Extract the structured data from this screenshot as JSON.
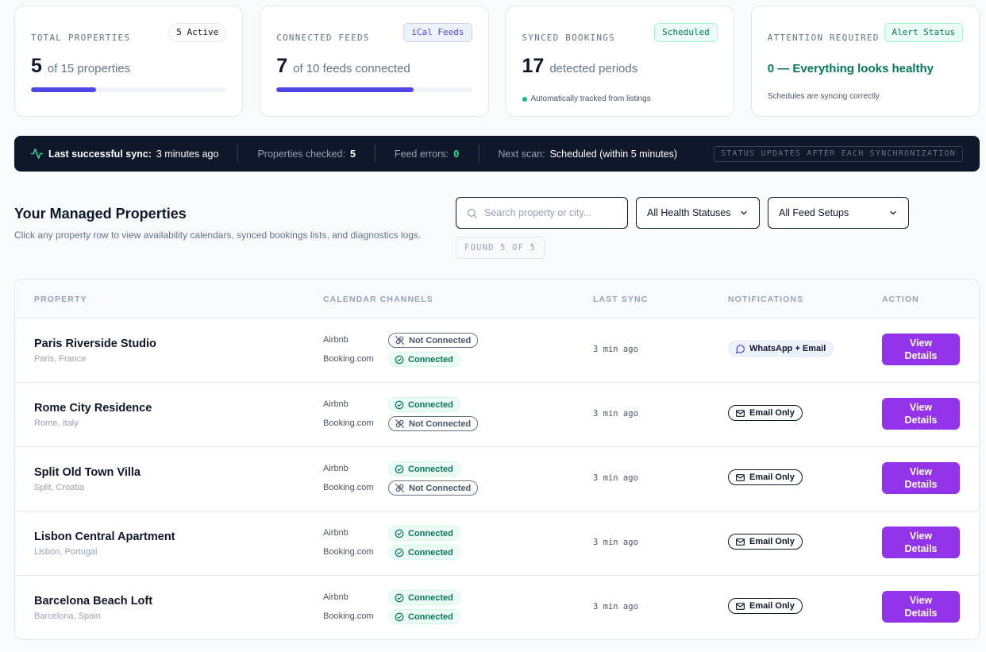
{
  "cards": {
    "properties": {
      "label": "TOTAL PROPERTIES",
      "badge": "5 Active",
      "value": "5",
      "suffix": "of 15 properties",
      "progress": 0.333
    },
    "feeds": {
      "label": "CONNECTED FEEDS",
      "badge": "iCal Feeds",
      "value": "7",
      "suffix": "of 10 feeds connected",
      "progress": 0.7
    },
    "bookings": {
      "label": "SYNCED BOOKINGS",
      "badge": "Scheduled",
      "value": "17",
      "suffix": "detected periods",
      "note": "Automatically tracked from listings"
    },
    "attention": {
      "label": "ATTENTION REQUIRED",
      "badge": "Alert Status",
      "headline": "0 — Everything looks healthy",
      "note": "Schedules are syncing correctly"
    }
  },
  "sync_bar": {
    "last_sync_label": "Last successful sync:",
    "last_sync_value": "3 minutes ago",
    "checked_label": "Properties checked:",
    "checked_value": "5",
    "errors_label": "Feed errors:",
    "errors_value": "0",
    "next_label": "Next scan:",
    "next_value": "Scheduled (within 5 minutes)",
    "note": "STATUS UPDATES AFTER EACH SYNCHRONIZATION"
  },
  "section": {
    "title": "Your Managed Properties",
    "description": "Click any property row to view availability calendars, synced bookings lists, and diagnostics logs."
  },
  "filters": {
    "search_placeholder": "Search property or city...",
    "health": "All Health Statuses",
    "feed_setup": "All Feed Setups",
    "found": "FOUND 5 OF 5"
  },
  "table": {
    "headers": {
      "property": "PROPERTY",
      "channels": "CALENDAR CHANNELS",
      "last_sync": "LAST SYNC",
      "notifications": "NOTIFICATIONS",
      "action": "ACTION"
    },
    "rows": [
      {
        "name": "Paris Riverside Studio",
        "location": "Paris, France",
        "airbnb_label": "Airbnb",
        "airbnb_status": "Not Connected",
        "booking_label": "Booking.com",
        "booking_status": "Connected",
        "last_sync": "3 min ago",
        "notification": "WhatsApp + Email",
        "action": "View Details"
      },
      {
        "name": "Rome City Residence",
        "location": "Rome, Italy",
        "airbnb_label": "Airbnb",
        "airbnb_status": "Connected",
        "booking_label": "Booking.com",
        "booking_status": "Not Connected",
        "last_sync": "3 min ago",
        "notification": "Email Only",
        "action": "View Details"
      },
      {
        "name": "Split Old Town Villa",
        "location": "Split, Croatia",
        "airbnb_label": "Airbnb",
        "airbnb_status": "Connected",
        "booking_label": "Booking.com",
        "booking_status": "Not Connected",
        "last_sync": "3 min ago",
        "notification": "Email Only",
        "action": "View Details"
      },
      {
        "name": "Lisbon Central Apartment",
        "location": "Lisbon, Portugal",
        "airbnb_label": "Airbnb",
        "airbnb_status": "Connected",
        "booking_label": "Booking.com",
        "booking_status": "Connected",
        "last_sync": "3 min ago",
        "notification": "Email Only",
        "action": "View Details"
      },
      {
        "name": "Barcelona Beach Loft",
        "location": "Barcelona, Spain",
        "airbnb_label": "Airbnb",
        "airbnb_status": "Connected",
        "booking_label": "Booking.com",
        "booking_status": "Connected",
        "last_sync": "3 min ago",
        "notification": "Email Only",
        "action": "View Details"
      }
    ]
  },
  "colors": {
    "accent": "#4f46e5",
    "button": "#9333ea",
    "success": "#047857",
    "dark": "#0f172a"
  }
}
